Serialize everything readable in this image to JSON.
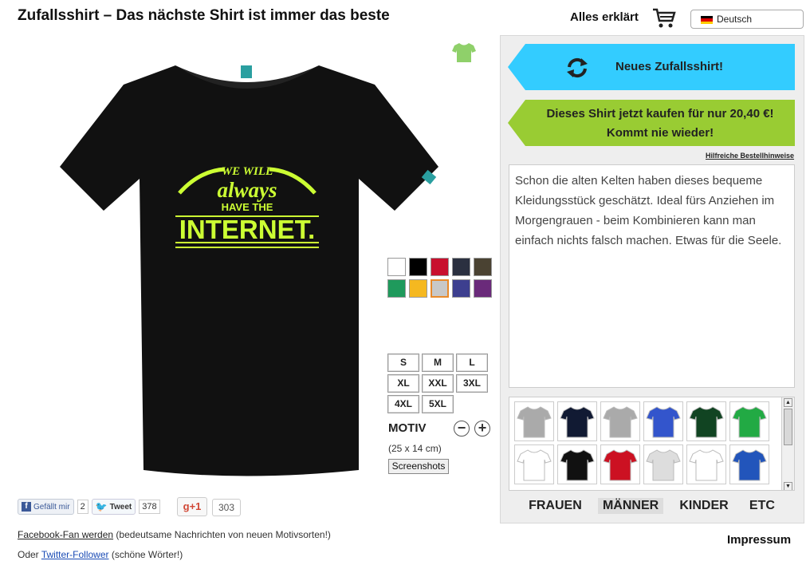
{
  "header": {
    "title": "Zufallsshirt – Das nächste Shirt ist immer das beste",
    "explain": "Alles erklärt",
    "language": "Deutsch"
  },
  "shirt": {
    "print_line1": "WE WILL",
    "print_line2": "always",
    "print_line3": "HAVE THE",
    "print_line4": "INTERNET.",
    "shirt_color": "#111111",
    "print_color": "#ccff33"
  },
  "swatches": [
    "#ffffff",
    "#000000",
    "#c8102e",
    "#2b3040",
    "#4a4232",
    "#1f9a5c",
    "#f5b820",
    "#c8c8c8",
    "#3d3f8f",
    "#6a2a7a"
  ],
  "selected_swatch": 7,
  "sizes": [
    "S",
    "M",
    "L",
    "XL",
    "XXL",
    "3XL",
    "4XL",
    "5XL"
  ],
  "motiv": {
    "label": "MOTIV",
    "dimensions": "(25 x 14 cm)",
    "screenshots": "Screenshots"
  },
  "social": {
    "fb_like": "Gefällt mir",
    "fb_count": "2",
    "tweet": "Tweet",
    "tweet_count": "378",
    "gplus": "+1",
    "gplus_count": "303"
  },
  "footer": {
    "fb_link": "Facebook-Fan werden",
    "fb_text": "(bedeutsame Nachrichten von neuen Motivsorten!)",
    "tw_prefix": "Oder",
    "tw_link": "Twitter-Follower",
    "tw_text": "(schöne Wörter!)",
    "imprint": "Impressum"
  },
  "panel": {
    "new_shirt": "Neues Zufallsshirt!",
    "buy_line1": "Dieses Shirt jetzt kaufen für nur 20,40 €!",
    "buy_line2": "Kommt nie wieder!",
    "hints": "Hilfreiche Bestellhinweise",
    "description": "Schon die alten Kelten haben dieses bequeme Kleidungsstück geschätzt. Ideal fürs Anziehen im Morgengrauen - beim Kombinieren kann man einfach nichts falsch machen. Etwas für die Seele.",
    "new_color": "#33ccff",
    "buy_color": "#99cc33"
  },
  "gallery": {
    "thumbs": [
      "#aaaaaa",
      "#111a33",
      "#aaaaaa",
      "#3355cc",
      "#114422",
      "#22aa44",
      "#ffffff",
      "#111111",
      "#cc1122",
      "#dddddd",
      "#ffffff",
      "#2255bb"
    ]
  },
  "categories": [
    "FRAUEN",
    "MÄNNER",
    "KINDER",
    "ETC"
  ],
  "active_category": 1
}
